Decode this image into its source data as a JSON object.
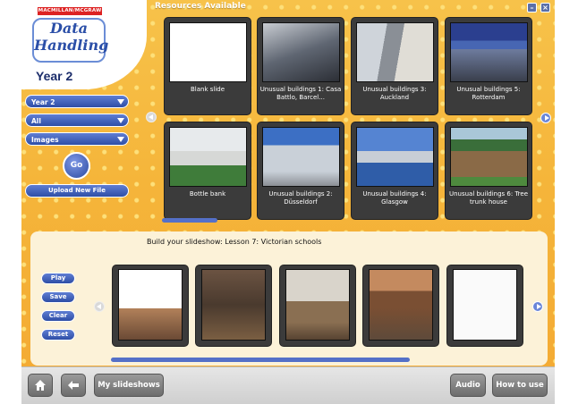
{
  "window": {
    "title": "Resources Available"
  },
  "logo": {
    "brand": "MACMILLAN/MCGRAW",
    "line1": "Data",
    "line2": "Handling",
    "year": "Year 2"
  },
  "filters": {
    "year": "Year 2",
    "category": "All",
    "type": "Images"
  },
  "buttons": {
    "go": "Go",
    "upload": "Upload New File"
  },
  "resources": [
    {
      "label": "Blank slide"
    },
    {
      "label": "Unusual buildings 1: Casa Battlo, Barcel..."
    },
    {
      "label": "Unusual buildings 3: Auckland"
    },
    {
      "label": "Unusual buildings 5: Rotterdam"
    },
    {
      "label": "Bottle bank"
    },
    {
      "label": "Unusual buildings 2: Düsseldorf"
    },
    {
      "label": "Unusual buildings 4: Glasgow"
    },
    {
      "label": "Unusual buildings 6: Tree trunk house"
    }
  ],
  "slideshow": {
    "title": "Build your slideshow: Lesson 7: Victorian schools",
    "controls": {
      "play": "Play",
      "save": "Save",
      "clear": "Clear",
      "reset": "Reset"
    }
  },
  "bottom": {
    "home_icon": "home-icon",
    "back_icon": "back-arrow-icon",
    "my_slideshows": "My slideshows",
    "audio": "Audio",
    "how_to_use": "How to use"
  },
  "colors": {
    "accent": "#2e4ea6",
    "background": "#f5b53a",
    "card": "#3b3b3b"
  }
}
